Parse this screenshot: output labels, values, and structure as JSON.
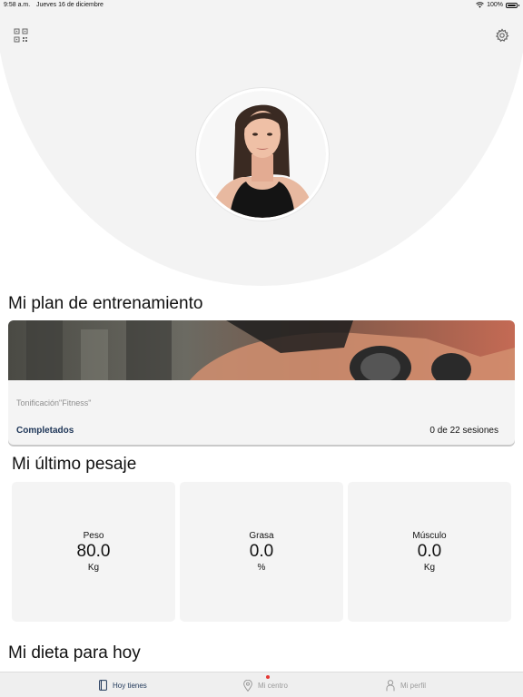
{
  "status_bar": {
    "time": "9:58 a.m.",
    "date": "Jueves 16 de diciembre",
    "battery": "100%",
    "icons": [
      "wifi-icon",
      "battery-icon"
    ]
  },
  "header": {
    "left_icon": "qr-code-icon",
    "right_icon": "gear-icon",
    "avatar": "profile-photo"
  },
  "training_plan": {
    "section_title": "Mi plan de entrenamiento",
    "plan_name": "Tonificación\"Fitness\"",
    "completed_label": "Completados",
    "sessions_text": "0 de 22 sesiones"
  },
  "weigh_in": {
    "section_title": "Mi último pesaje",
    "cards": [
      {
        "label": "Peso",
        "value": "80.0",
        "unit": "Kg"
      },
      {
        "label": "Grasa",
        "value": "0.0",
        "unit": "%"
      },
      {
        "label": "Músculo",
        "value": "0.0",
        "unit": "Kg"
      }
    ]
  },
  "diet": {
    "section_title": "Mi dieta para hoy"
  },
  "tab_bar": {
    "tabs": [
      {
        "label": "Hoy tienes",
        "icon": "book-icon",
        "active": true
      },
      {
        "label": "Mi centro",
        "icon": "location-pin-icon",
        "active": false,
        "badge": true
      },
      {
        "label": "Mi perfil",
        "icon": "person-icon",
        "active": false
      }
    ],
    "colors": {
      "active": "#1d3557",
      "inactive": "#9a9a9a",
      "badge": "#e53935"
    }
  }
}
